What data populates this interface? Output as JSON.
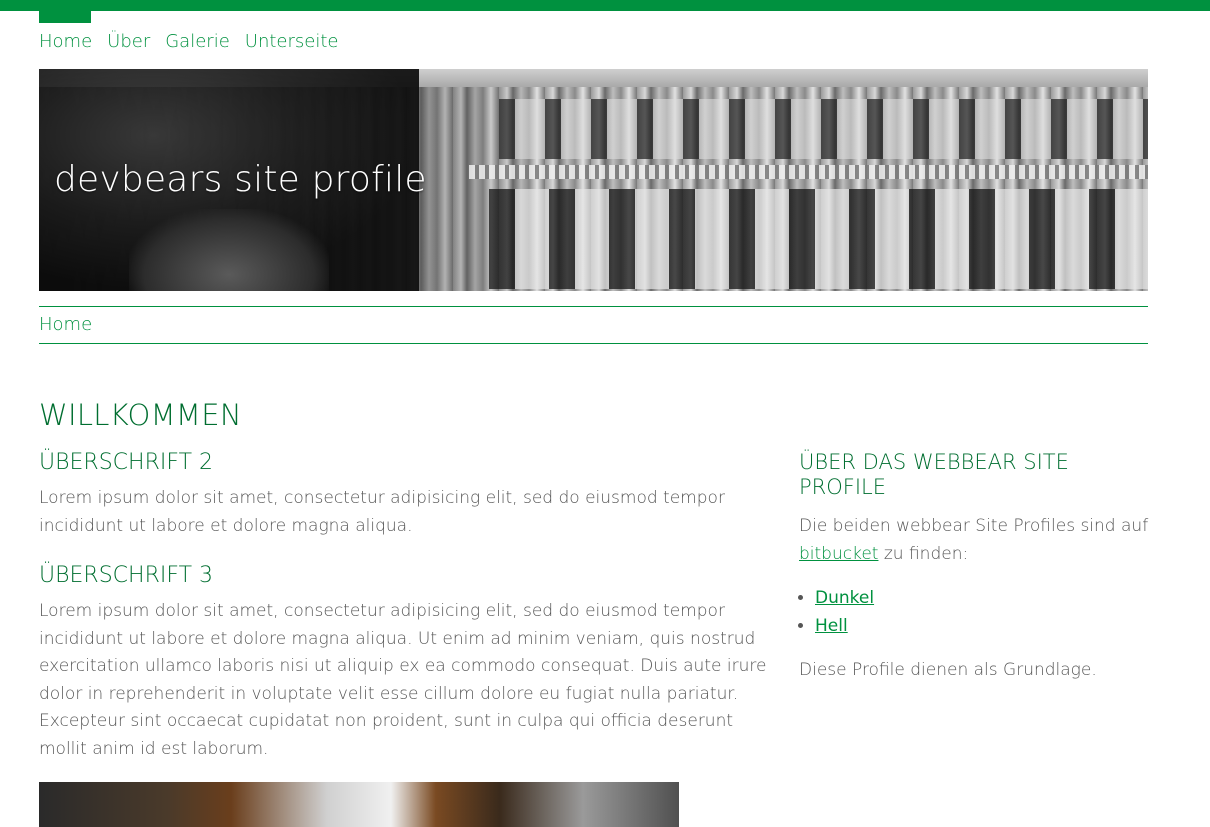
{
  "nav": {
    "items": [
      "Home",
      "Über",
      "Galerie",
      "Unterseite"
    ]
  },
  "hero": {
    "title": "devbears site profile"
  },
  "breadcrumb": {
    "home": "Home"
  },
  "page": {
    "title": "WILLKOMMEN",
    "h2": "ÜBERSCHRIFT 2",
    "p1": "Lorem ipsum dolor sit amet, consectetur adipisicing elit, sed do eiusmod tempor incididunt ut labore et dolore magna aliqua.",
    "h3": "ÜBERSCHRIFT 3",
    "p2": "Lorem ipsum dolor sit amet, consectetur adipisicing elit, sed do eiusmod tempor incididunt ut labore et dolore magna aliqua. Ut enim ad minim veniam, quis nostrud exercitation ullamco laboris nisi ut aliquip ex ea commodo consequat. Duis aute irure dolor in reprehenderit in voluptate velit esse cillum dolore eu fugiat nulla pariatur. Excepteur sint occaecat cupidatat non proident, sunt in culpa qui officia deserunt mollit anim id est laborum."
  },
  "sidebar": {
    "title": "ÜBER DAS WEBBEAR SITE PROFILE",
    "intro_before": "Die beiden webbear Site Profiles sind auf",
    "link_bitbucket": "bitbucket",
    "intro_after": "zu finden:",
    "links": [
      "Dunkel",
      "Hell"
    ],
    "outro": "Diese Profile dienen als Grundlage."
  },
  "colors": {
    "brand_green": "#00913f",
    "heading_green": "#006e30",
    "text_gray": "#555555"
  }
}
